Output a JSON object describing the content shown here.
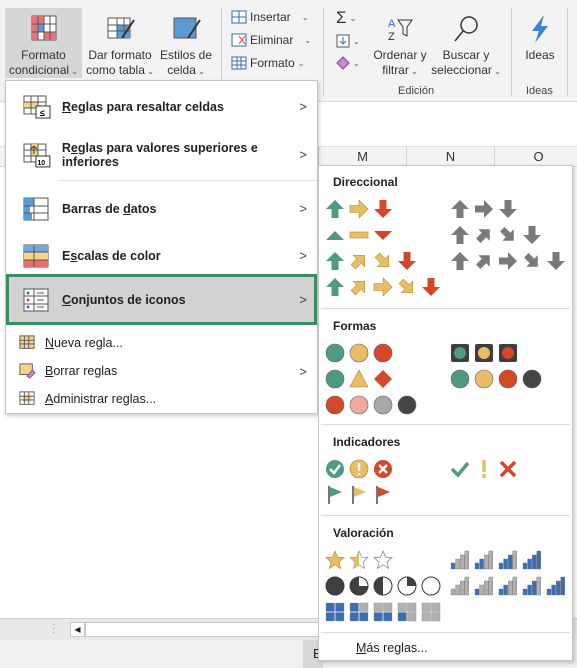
{
  "ribbon": {
    "formato_condicional": [
      "Formato",
      "condicional"
    ],
    "dar_formato": [
      "Dar formato",
      "como tabla"
    ],
    "estilos": [
      "Estilos de",
      "celda"
    ],
    "insertar": "Insertar",
    "eliminar": "Eliminar",
    "formato": "Formato",
    "ordenar": [
      "Ordenar y",
      "filtrar"
    ],
    "buscar": [
      "Buscar y",
      "seleccionar"
    ],
    "ideas": "Ideas",
    "group_edicion": "Edición",
    "group_ideas": "Ideas",
    "sum_icon": "Σ"
  },
  "columns": [
    "M",
    "N",
    "O"
  ],
  "menu": {
    "items": [
      {
        "pre": "",
        "u": "R",
        "post": "eglas para resaltar celdas",
        "icon": "highlight-cells-icon"
      },
      {
        "pre": "R",
        "u": "e",
        "post": "glas para valores superiores e inferiores",
        "icon": "top-bottom-icon"
      },
      {
        "pre": "Barras de ",
        "u": "d",
        "post": "atos",
        "icon": "data-bars-icon"
      },
      {
        "pre": "E",
        "u": "s",
        "post": "calas de color",
        "icon": "color-scales-icon"
      },
      {
        "pre": "",
        "u": "C",
        "post": "onjuntos de iconos",
        "icon": "icon-sets-icon"
      },
      {
        "pre": "",
        "u": "N",
        "post": "ueva regla...",
        "icon": "new-rule-icon"
      },
      {
        "pre": "",
        "u": "B",
        "post": "orrar reglas",
        "icon": "clear-rules-icon"
      },
      {
        "pre": "",
        "u": "A",
        "post": "dministrar reglas...",
        "icon": "manage-rules-icon"
      }
    ],
    "submenu_arrow": ">"
  },
  "submenu": {
    "colors": {
      "green": "#4f9a82",
      "yellow": "#e8bd66",
      "red": "#d4482a",
      "gray": "#7a7a7a",
      "blue": "#3a6fb5",
      "dark": "#454545"
    },
    "sections": [
      {
        "title": "Direccional",
        "left": [
          [
            "up:green",
            "right:yellow",
            "down:red"
          ],
          [
            "triup:green",
            "dash:yellow",
            "tridown:red"
          ],
          [
            "up:green",
            "ne:yellow",
            "se:yellow",
            "down:red"
          ],
          [
            "up:green",
            "ne:yellow",
            "right:yellow",
            "se:yellow",
            "down:red"
          ]
        ],
        "right": [
          [
            "up:gray",
            "right:gray",
            "down:gray"
          ],
          [
            "up:gray",
            "ne:gray",
            "se:gray",
            "down:gray"
          ],
          [
            "up:gray",
            "ne:gray",
            "right:gray",
            "se:gray",
            "down:gray"
          ]
        ]
      },
      {
        "title": "Formas",
        "left": [
          [
            "circle:green",
            "circle:yellow",
            "circle:red"
          ],
          [
            "circle:green",
            "triangle:yellow",
            "diamond:red"
          ],
          [
            "circle:red",
            "circle:pink",
            "circle:lgray",
            "circle:dark"
          ]
        ],
        "right": [
          [
            "light:green",
            "light:yellow",
            "light:red"
          ],
          [
            "circle:green",
            "circle:yellow",
            "circle:red",
            "circle:dark"
          ]
        ]
      },
      {
        "title": "Indicadores",
        "left": [
          [
            "ccheck:green",
            "cexcl:yellow",
            "cx:red"
          ],
          [
            "flag:green",
            "flag:yellow",
            "flag:red"
          ]
        ],
        "right": [
          [
            "check:green",
            "excl:yellow",
            "x:red"
          ]
        ]
      },
      {
        "title": "Valoración",
        "left": [
          [
            "star:2",
            "star:1",
            "star:0"
          ],
          [
            "pie:4",
            "pie:3",
            "pie:2",
            "pie:1",
            "pie:0"
          ],
          [
            "box:4",
            "box:3",
            "box:2",
            "box:1",
            "box:0"
          ]
        ],
        "right": [
          [
            "bars:1",
            "bars:2",
            "bars:3",
            "bars:4"
          ],
          [
            "bars:0",
            "bars:1",
            "bars:2",
            "bars:3",
            "bars:4"
          ]
        ]
      }
    ],
    "more_u": "M",
    "more_post": "ás reglas..."
  },
  "status": {
    "partial": "E"
  }
}
